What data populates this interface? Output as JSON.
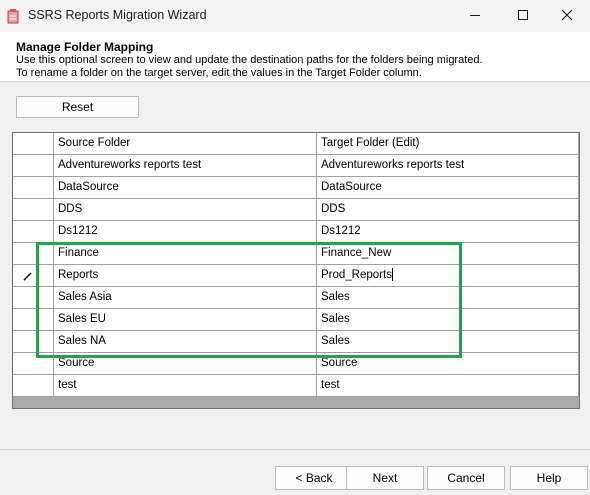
{
  "window": {
    "title": "SSRS Reports Migration Wizard",
    "icon": "report-icon"
  },
  "header": {
    "title": "Manage Folder Mapping",
    "desc_line1": "Use this optional screen to view and update the destination paths for the folders being migrated.",
    "desc_line2": "To rename a folder on the target server, edit the values in the Target Folder column."
  },
  "reset_label": "Reset",
  "grid": {
    "columns": [
      "Source Folder",
      "Target Folder (Edit)"
    ],
    "rows": [
      {
        "source": "Adventureworks reports test",
        "target": "Adventureworks reports test"
      },
      {
        "source": "DataSource",
        "target": "DataSource"
      },
      {
        "source": "DDS",
        "target": "DDS"
      },
      {
        "source": "Ds1212",
        "target": "Ds1212"
      },
      {
        "source": "Finance",
        "target": "Finance_New"
      },
      {
        "source": "Reports",
        "target": "Prod_Reports"
      },
      {
        "source": "Sales Asia",
        "target": "Sales"
      },
      {
        "source": "Sales EU",
        "target": "Sales"
      },
      {
        "source": "Sales NA",
        "target": "Sales"
      },
      {
        "source": "Source",
        "target": "Source"
      },
      {
        "source": "test",
        "target": "test"
      }
    ]
  },
  "footer": {
    "back": "< Back",
    "next": "Next",
    "cancel": "Cancel",
    "help": "Help"
  },
  "colors": {
    "highlight": "#26a34a",
    "grid_bg": "#ababab"
  }
}
